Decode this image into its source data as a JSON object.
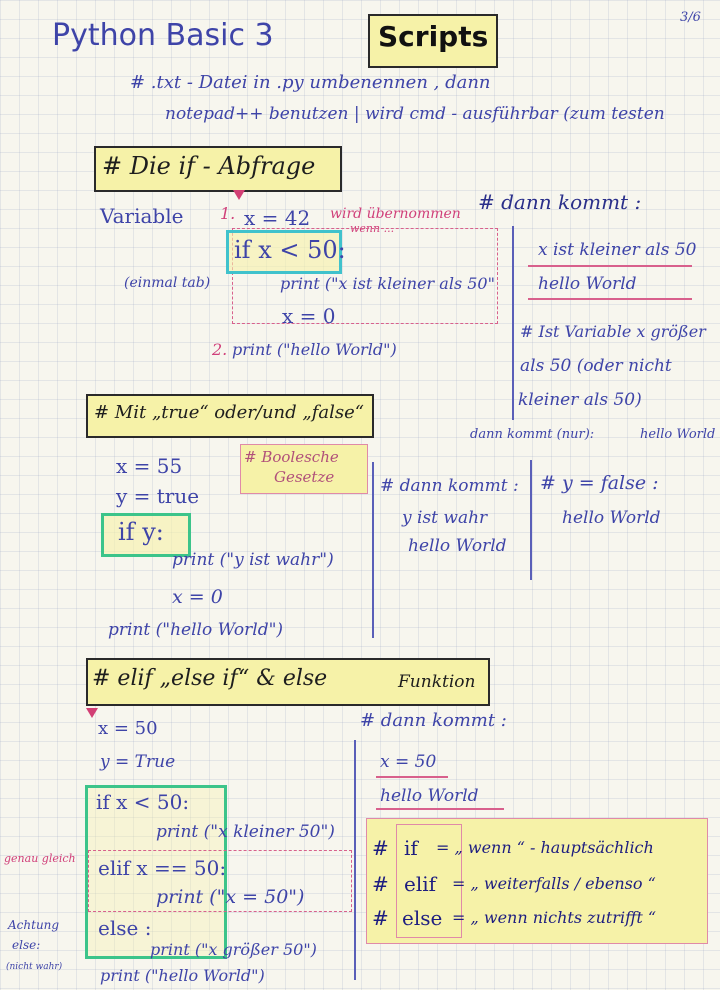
{
  "header": {
    "title": "Python Basic 3",
    "scripts_label": "Scripts",
    "page_number": "3/6",
    "note_line1": "# .txt - Datei in .py umbenennen , dann",
    "note_line2": "notepad++ benutzen | wird cmd - ausführbar (zum testen"
  },
  "section_if": {
    "heading": "# Die if - Abfrage",
    "label_variable": "Variable",
    "marker_1": "1.",
    "line_assign": "x = 42",
    "note_taken": "wird übernommen",
    "note_if": "wenn ...",
    "line_if": "if x < 50:",
    "label_tab": "(einmal tab)",
    "line_print": "print (\"x ist kleiner als 50\"",
    "line_x0": "x = 0",
    "marker_2": "2.",
    "line_print2": "print (\"hello World\")",
    "result_heading": "# dann kommt :",
    "result_1": "x ist kleiner als 50",
    "result_2": "hello World",
    "else_note_1": "# Ist Variable x größer",
    "else_note_2": "als 50 (oder nicht",
    "else_note_3": "kleiner als 50)",
    "else_note_4": "dann kommt (nur):",
    "else_note_5": "hello World"
  },
  "section_bool": {
    "heading": "# Mit „true“ oder/und „false“",
    "line_x": "x = 55",
    "line_y": "y = true",
    "line_if": "if y:",
    "line_print": "print (\"y ist wahr\")",
    "line_x0": "x = 0",
    "line_print2": "print (\"hello World\")",
    "note_1": "# Boolesche",
    "note_2": "Gesetze",
    "result_heading": "# dann kommt :",
    "result_1": "y ist wahr",
    "result_2": "hello World",
    "false_heading": "# y = false :",
    "false_result": "hello World"
  },
  "section_elif": {
    "heading": "# elif „else if“ & else",
    "heading_suffix": "Funktion",
    "line_x": "x = 50",
    "line_y": "y = True",
    "line_if": "if x < 50:",
    "line_print1": "print (\"x kleiner 50\")",
    "line_elif": "elif x == 50:",
    "line_print2": "print (\"x = 50\")",
    "line_else": "else :",
    "line_print3": "print (\"x größer 50\")",
    "line_print4": "print (\"hello World\")",
    "side_note_equal": "genau gleich",
    "side_note_attention": "Achtung",
    "side_note_else": "else:",
    "side_note_small": "(nicht wahr)",
    "result_heading": "# dann kommt :",
    "result_1": "x = 50",
    "result_2": "hello World",
    "legend": [
      {
        "key": "if",
        "text": "= „ wenn “ - hauptsächlich"
      },
      {
        "key": "elif",
        "text": "= „ weiterfalls / ebenso “"
      },
      {
        "key": "else",
        "text": "= „ wenn nichts zutrifft “"
      }
    ]
  },
  "colors": {
    "ink": "#3e44a8",
    "pink": "#d0407a",
    "highlight": "#f6f2a8",
    "green": "#3cc48a"
  }
}
